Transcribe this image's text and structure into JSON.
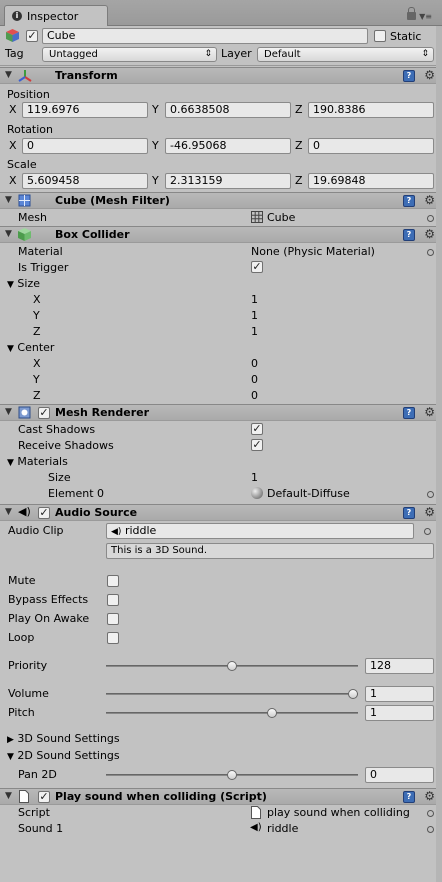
{
  "tab": {
    "title": "Inspector"
  },
  "object": {
    "name": "Cube",
    "static_label": "Static",
    "tag_label": "Tag",
    "tag_value": "Untagged",
    "layer_label": "Layer",
    "layer_value": "Default"
  },
  "transform": {
    "title": "Transform",
    "position_label": "Position",
    "rotation_label": "Rotation",
    "scale_label": "Scale",
    "x": "X",
    "y": "Y",
    "z": "Z",
    "position": [
      "119.6976",
      "0.6638508",
      "190.8386"
    ],
    "rotation": [
      "0",
      "-46.95068",
      "0"
    ],
    "scale": [
      "5.609458",
      "2.313159",
      "19.69848"
    ]
  },
  "mesh_filter": {
    "title": "Cube (Mesh Filter)",
    "mesh_label": "Mesh",
    "mesh_value": "Cube"
  },
  "box_collider": {
    "title": "Box Collider",
    "material_label": "Material",
    "material_value": "None (Physic Material)",
    "trigger_label": "Is Trigger",
    "size_label": "Size",
    "size": [
      {
        "k": "X",
        "v": "1"
      },
      {
        "k": "Y",
        "v": "1"
      },
      {
        "k": "Z",
        "v": "1"
      }
    ],
    "center_label": "Center",
    "center": [
      {
        "k": "X",
        "v": "0"
      },
      {
        "k": "Y",
        "v": "0"
      },
      {
        "k": "Z",
        "v": "0"
      }
    ]
  },
  "mesh_renderer": {
    "title": "Mesh Renderer",
    "cast_label": "Cast Shadows",
    "receive_label": "Receive Shadows",
    "materials_label": "Materials",
    "size_label": "Size",
    "size_value": "1",
    "element_label": "Element 0",
    "element_value": "Default-Diffuse"
  },
  "audio_source": {
    "title": "Audio Source",
    "clip_label": "Audio Clip",
    "clip_value": "riddle",
    "info": "This is a 3D Sound.",
    "mute_label": "Mute",
    "bypass_label": "Bypass Effects",
    "awake_label": "Play On Awake",
    "loop_label": "Loop",
    "priority_label": "Priority",
    "priority_value": "128",
    "priority_pos": 0.5,
    "volume_label": "Volume",
    "volume_value": "1",
    "volume_pos": 1.0,
    "pitch_label": "Pitch",
    "pitch_value": "1",
    "pitch_pos": 0.667,
    "sound3d_label": "3D Sound Settings",
    "sound2d_label": "2D Sound Settings",
    "pan_label": "Pan 2D",
    "pan_value": "0",
    "pan_pos": 0.5
  },
  "script": {
    "title": "Play sound when colliding (Script)",
    "script_label": "Script",
    "script_value": "play sound when colliding",
    "sound_label": "Sound 1",
    "sound_value": "riddle"
  }
}
